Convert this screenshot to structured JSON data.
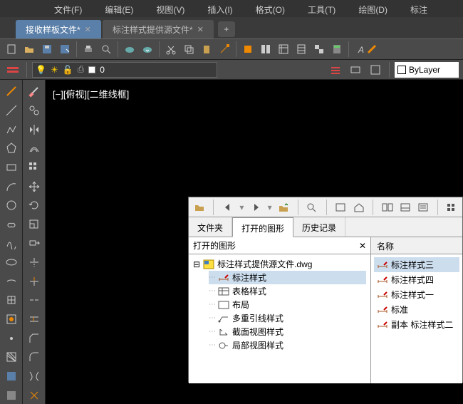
{
  "menu": [
    "文件(F)",
    "编辑(E)",
    "视图(V)",
    "插入(I)",
    "格式(O)",
    "工具(T)",
    "绘图(D)",
    "标注"
  ],
  "tabs": [
    {
      "label": "接收样板文件*",
      "active": true
    },
    {
      "label": "标注样式提供源文件*",
      "active": false
    }
  ],
  "bylayer": "ByLayer",
  "layer_combo": "0",
  "viewlabel": "[−][俯视][二维线框]",
  "panel": {
    "tabs": [
      "文件夹",
      "打开的图形",
      "历史记录"
    ],
    "tree_header": "打开的图形",
    "root": "标注样式提供源文件.dwg",
    "children": [
      "标注样式",
      "表格样式",
      "布局",
      "多重引线样式",
      "截面视图样式",
      "局部视图样式"
    ],
    "list_header": "名称",
    "list": [
      "标注样式三",
      "标注样式四",
      "标注样式一",
      "标准",
      "副本 标注样式二"
    ]
  }
}
